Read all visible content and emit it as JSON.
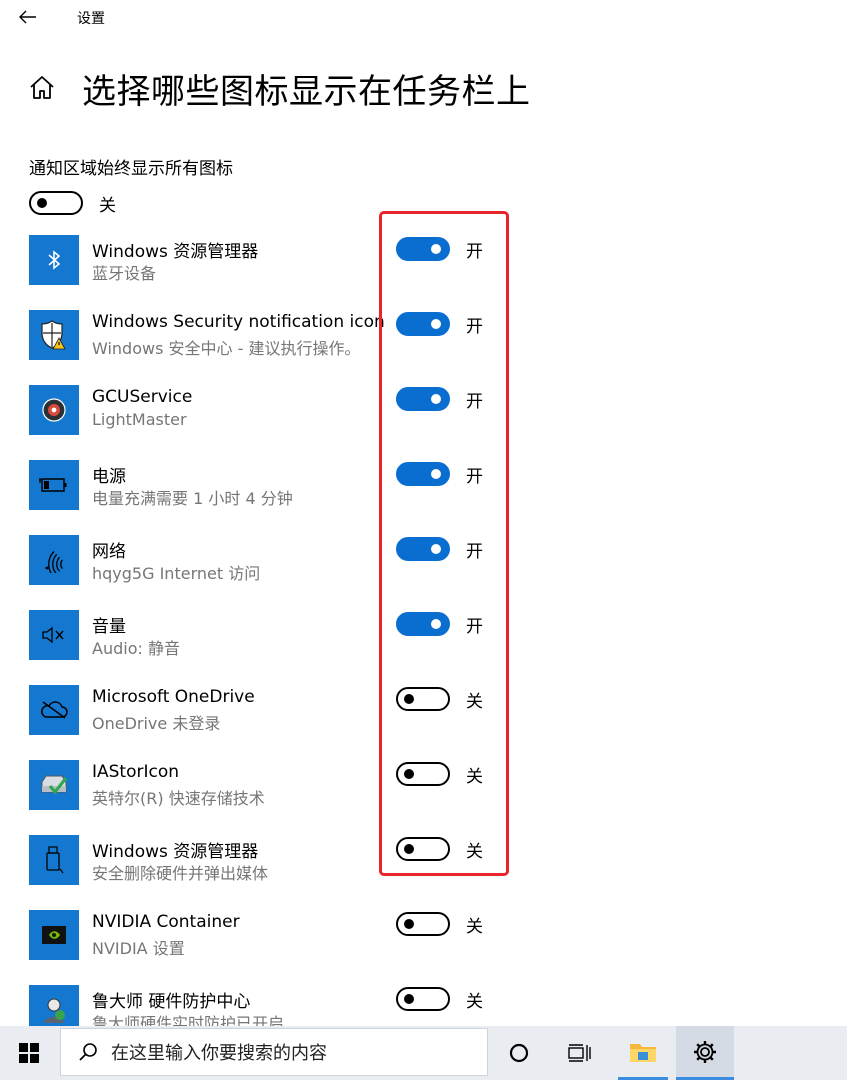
{
  "window": {
    "app_title": "设置"
  },
  "page": {
    "title": "选择哪些图标显示在任务栏上",
    "always_show_label": "通知区域始终显示所有图标",
    "always_show_state": "关",
    "always_show_on": false
  },
  "items": [
    {
      "name": "Windows 资源管理器",
      "desc": "蓝牙设备",
      "state": "开",
      "on": true,
      "icon": "bluetooth-icon"
    },
    {
      "name": "Windows Security notification icon",
      "desc": "Windows 安全中心 - 建议执行操作。",
      "state": "开",
      "on": true,
      "icon": "security-shield-icon"
    },
    {
      "name": "GCUService",
      "desc": "LightMaster",
      "state": "开",
      "on": true,
      "icon": "gcu-service-icon"
    },
    {
      "name": "电源",
      "desc": "电量充满需要 1 小时 4 分钟",
      "state": "开",
      "on": true,
      "icon": "battery-icon"
    },
    {
      "name": "网络",
      "desc": "hqyg5G Internet 访问",
      "state": "开",
      "on": true,
      "icon": "wifi-icon"
    },
    {
      "name": "音量",
      "desc": "Audio: 静音",
      "state": "开",
      "on": true,
      "icon": "volume-muted-icon"
    },
    {
      "name": "Microsoft OneDrive",
      "desc": "OneDrive 未登录",
      "state": "关",
      "on": false,
      "icon": "onedrive-icon"
    },
    {
      "name": "IAStorIcon",
      "desc": "英特尔(R) 快速存储技术",
      "state": "关",
      "on": false,
      "icon": "intel-storage-icon"
    },
    {
      "name": "Windows 资源管理器",
      "desc": "安全删除硬件并弹出媒体",
      "state": "关",
      "on": false,
      "icon": "usb-eject-icon"
    },
    {
      "name": "NVIDIA Container",
      "desc": "NVIDIA 设置",
      "state": "关",
      "on": false,
      "icon": "nvidia-icon"
    },
    {
      "name": "鲁大师 硬件防护中心",
      "desc": "鲁大师硬件实时防护已开启",
      "state": "关",
      "on": false,
      "icon": "ludashi-icon"
    }
  ],
  "taskbar": {
    "search_placeholder": "在这里输入你要搜索的内容",
    "buttons": [
      "windows-start-icon",
      "cortana-icon",
      "task-view-icon",
      "file-explorer-icon",
      "settings-gear-icon"
    ]
  },
  "colors": {
    "accent": "#0a6ed1",
    "tile": "#1478d0",
    "highlight": "#e8252a",
    "secondary_text": "#767676"
  }
}
